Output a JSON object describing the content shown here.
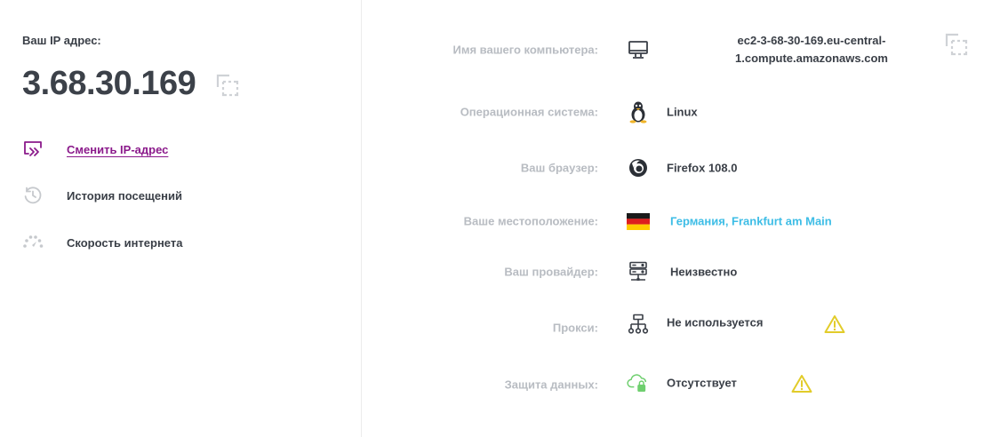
{
  "left": {
    "ip_label": "Ваш IP адрес:",
    "ip_value": "3.68.30.169",
    "menu": [
      {
        "label": "Сменить IP-адрес",
        "icon": "change-ip-icon"
      },
      {
        "label": "История посещений",
        "icon": "history-icon"
      },
      {
        "label": "Скорость интернета",
        "icon": "speedometer-icon"
      }
    ]
  },
  "info": {
    "computer_name": {
      "label": "Имя вашего компьютера:",
      "value_line1": "ec2-3-68-30-169.eu-central-",
      "value_line2": "1.compute.amazonaws.com",
      "icon": "monitor-icon"
    },
    "os": {
      "label": "Операционная система:",
      "value": "Linux",
      "icon": "linux-icon"
    },
    "browser": {
      "label": "Ваш браузер:",
      "value": "Firefox 108.0",
      "icon": "firefox-icon"
    },
    "location": {
      "label": "Ваше местоположение:",
      "value": "Германия, Frankfurt am Main",
      "icon": "germany-flag-icon"
    },
    "provider": {
      "label": "Ваш провайдер:",
      "value": "Неизвестно",
      "icon": "server-icon"
    },
    "proxy": {
      "label": "Прокси:",
      "value": "Не используется",
      "icon": "network-icon",
      "warning": true
    },
    "protection": {
      "label": "Защита данных:",
      "value": "Отсутствует",
      "icon": "cloud-lock-icon",
      "warning": true
    }
  },
  "colors": {
    "accent": "#8b1a8b",
    "link": "#3dbde6",
    "warning": "#e2cc2a",
    "muted_label": "#b8bcc2",
    "success": "#6fcf6f"
  }
}
